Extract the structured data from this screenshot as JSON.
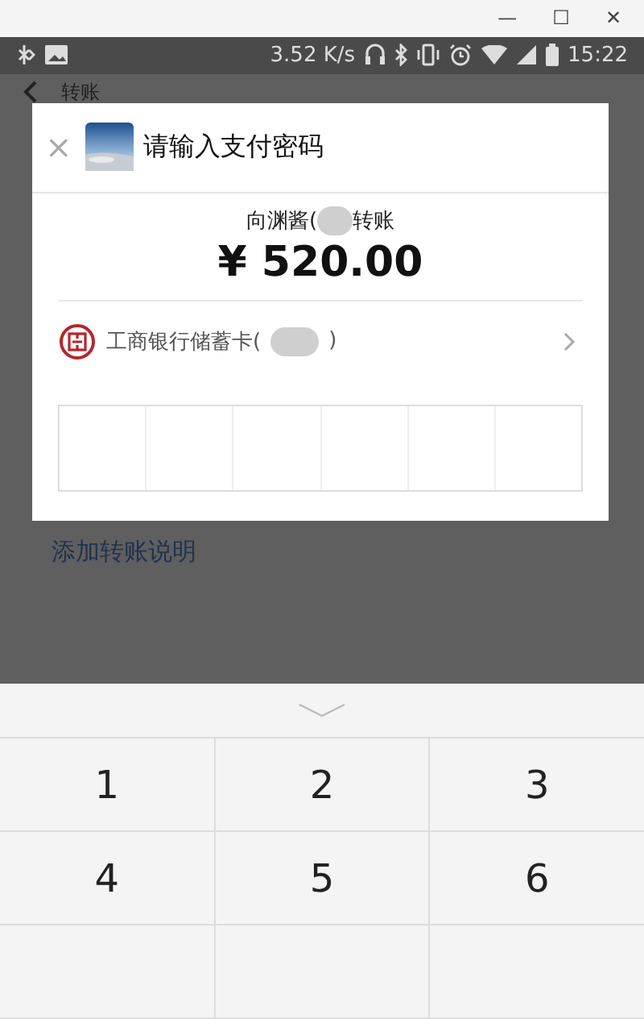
{
  "window": {
    "controls": [
      "—",
      "☐",
      "✕"
    ]
  },
  "status_bar": {
    "speed": "3.52 K/s",
    "time": "15:22"
  },
  "header": {
    "title": "转账"
  },
  "dialog": {
    "close": "×",
    "title": "请输入支付密码",
    "recipient_prefix": "向渊酱(",
    "recipient_suffix": "转账",
    "amount": "¥ 520.00",
    "card_prefix": "工商银行储蓄卡(",
    "card_suffix": ")",
    "password_boxes": [
      {
        "filled": false
      },
      {
        "filled": false
      },
      {
        "filled": false
      },
      {
        "filled": false
      },
      {
        "filled": false
      },
      {
        "filled": false
      }
    ]
  },
  "add_note": "添加转账说明",
  "keypad": {
    "rows": [
      [
        "1",
        "2",
        "3"
      ],
      [
        "4",
        "5",
        "6"
      ],
      []
    ]
  }
}
